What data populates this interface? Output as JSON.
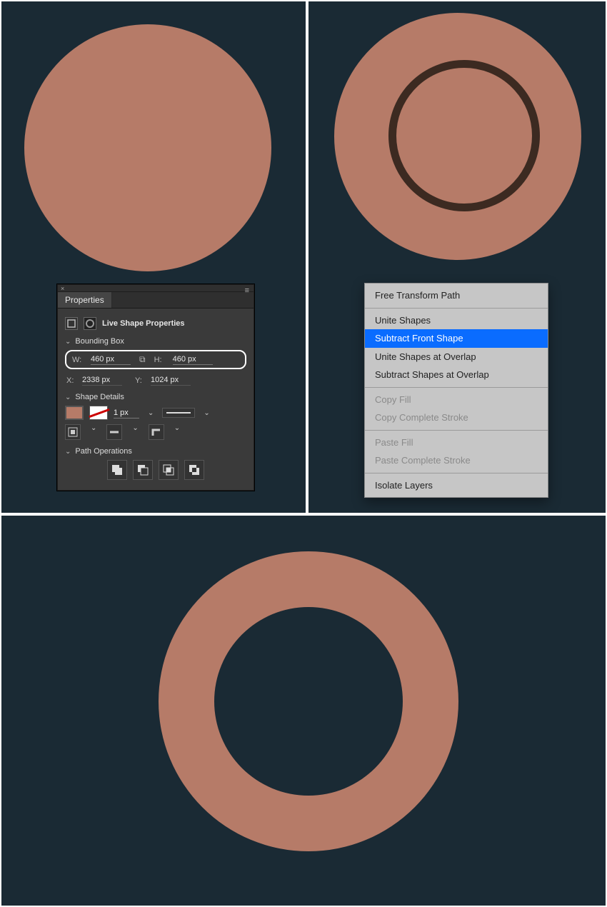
{
  "panel": {
    "title": "Properties",
    "subtitle": "Live Shape Properties",
    "bounding_box_label": "Bounding Box",
    "w_label": "W:",
    "h_label": "H:",
    "w_value": "460 px",
    "h_value": "460 px",
    "x_label": "X:",
    "y_label": "Y:",
    "x_value": "2338 px",
    "y_value": "1024 px",
    "shape_details_label": "Shape Details",
    "stroke_px": "1 px",
    "path_ops_label": "Path Operations",
    "fill_color": "#b67b68"
  },
  "context_menu": {
    "items": [
      {
        "label": "Free Transform Path",
        "state": "enabled"
      },
      {
        "sep": true
      },
      {
        "label": "Unite Shapes",
        "state": "enabled"
      },
      {
        "label": "Subtract Front Shape",
        "state": "selected"
      },
      {
        "label": "Unite Shapes at Overlap",
        "state": "enabled"
      },
      {
        "label": "Subtract Shapes at Overlap",
        "state": "enabled"
      },
      {
        "sep": true
      },
      {
        "label": "Copy Fill",
        "state": "disabled"
      },
      {
        "label": "Copy Complete Stroke",
        "state": "disabled"
      },
      {
        "sep": true
      },
      {
        "label": "Paste Fill",
        "state": "disabled"
      },
      {
        "label": "Paste Complete Stroke",
        "state": "disabled"
      },
      {
        "sep": true
      },
      {
        "label": "Isolate Layers",
        "state": "enabled"
      }
    ]
  },
  "colors": {
    "canvas_bg": "#1a2a34",
    "shape_fill": "#b67b68",
    "inner_ring_stroke": "#3c2a21"
  }
}
